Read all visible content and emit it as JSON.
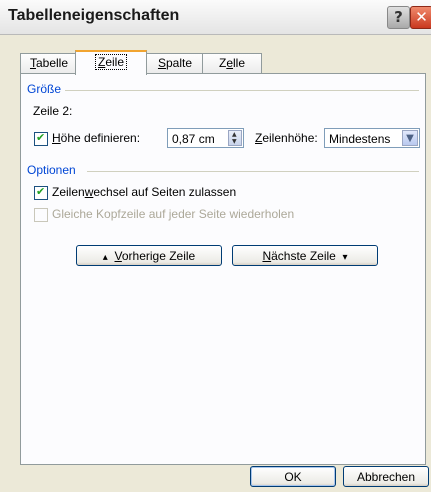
{
  "window": {
    "title": "Tabelleneigenschaften",
    "help_glyph": "?",
    "close_glyph": "✕"
  },
  "tabs": [
    {
      "label_pre": "",
      "label_u": "T",
      "label_post": "abelle"
    },
    {
      "label_pre": "",
      "label_u": "Z",
      "label_post": "eile"
    },
    {
      "label_pre": "",
      "label_u": "S",
      "label_post": "palte"
    },
    {
      "label_pre": "Z",
      "label_u": "e",
      "label_post": "lle"
    }
  ],
  "active_tab": "Zeile",
  "size_group": {
    "title": "Größe",
    "row_label": "Zeile 2:",
    "height_checkbox_u": "H",
    "height_checkbox_post": "öhe definieren:",
    "height_checked": true,
    "height_value": "0,87 cm",
    "row_height_label_u": "Z",
    "row_height_label_post": "eilenhöhe:",
    "row_height_selected": "Mindestens"
  },
  "options_group": {
    "title": "Optionen",
    "allow_break_pre": "Zeilen",
    "allow_break_u": "w",
    "allow_break_post": "echsel auf Seiten zulassen",
    "allow_break_checked": true,
    "repeat_header": "Gleiche Kopfzeile auf jeder Seite wiederholen",
    "repeat_header_checked": false
  },
  "nav": {
    "prev_arrow": "▴",
    "prev_u": "V",
    "prev_post": "orherige Zeile",
    "next_u": "N",
    "next_post": "ächste Zeile",
    "next_arrow": "▾"
  },
  "footer": {
    "ok": "OK",
    "cancel": "Abbrechen"
  }
}
